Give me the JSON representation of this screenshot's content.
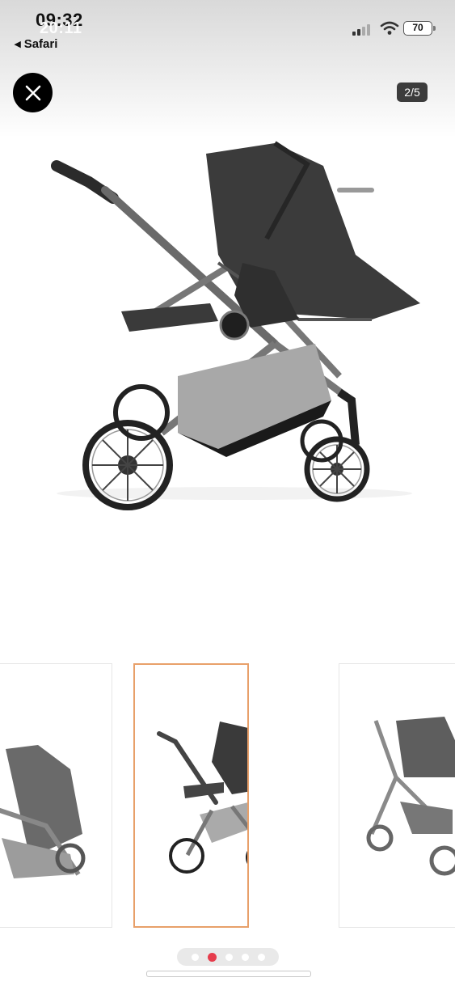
{
  "status_bar": {
    "time_back": "09:32",
    "time_front": "20:11",
    "back_app": "◂ Safari",
    "battery": "70"
  },
  "viewer": {
    "close_icon": "close-icon",
    "counter": "2/5"
  },
  "gallery": {
    "selected_index": 1,
    "thumbnail_count": 3
  },
  "pagination": {
    "total": 5,
    "active": 1,
    "active_color": "#e63c4c"
  },
  "colors": {
    "selected_border": "#e8a06a"
  }
}
